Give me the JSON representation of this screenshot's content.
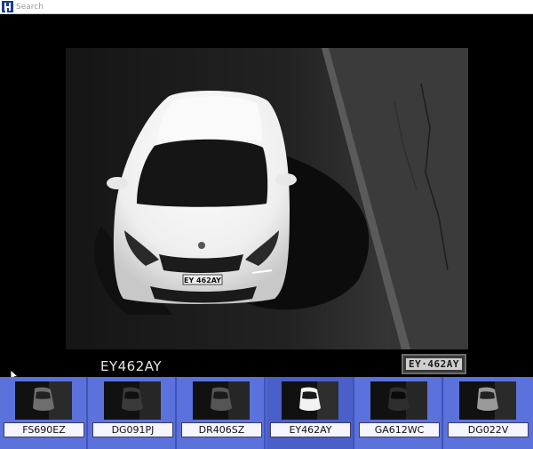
{
  "window": {
    "title": "Search"
  },
  "viewer": {
    "plate_text": "EY462AY",
    "plate_crop_text": "EY·462AY",
    "car_plate_text": "EY 462AY"
  },
  "thumbnails": [
    {
      "plate": "FS690EZ",
      "car": "dark"
    },
    {
      "plate": "DG091PJ",
      "car": "dark"
    },
    {
      "plate": "DR406SZ",
      "car": "dark"
    },
    {
      "plate": "EY462AY",
      "car": "white"
    },
    {
      "plate": "GA612WC",
      "car": "dark"
    },
    {
      "plate": "DG022V",
      "car": "light"
    }
  ],
  "colors": {
    "strip_bg": "#5a6fd6",
    "titlebar_bg": "#ffffff",
    "viewer_bg": "#000000"
  },
  "icons": {
    "app": "app-icon",
    "cursor": "cursor-icon"
  }
}
